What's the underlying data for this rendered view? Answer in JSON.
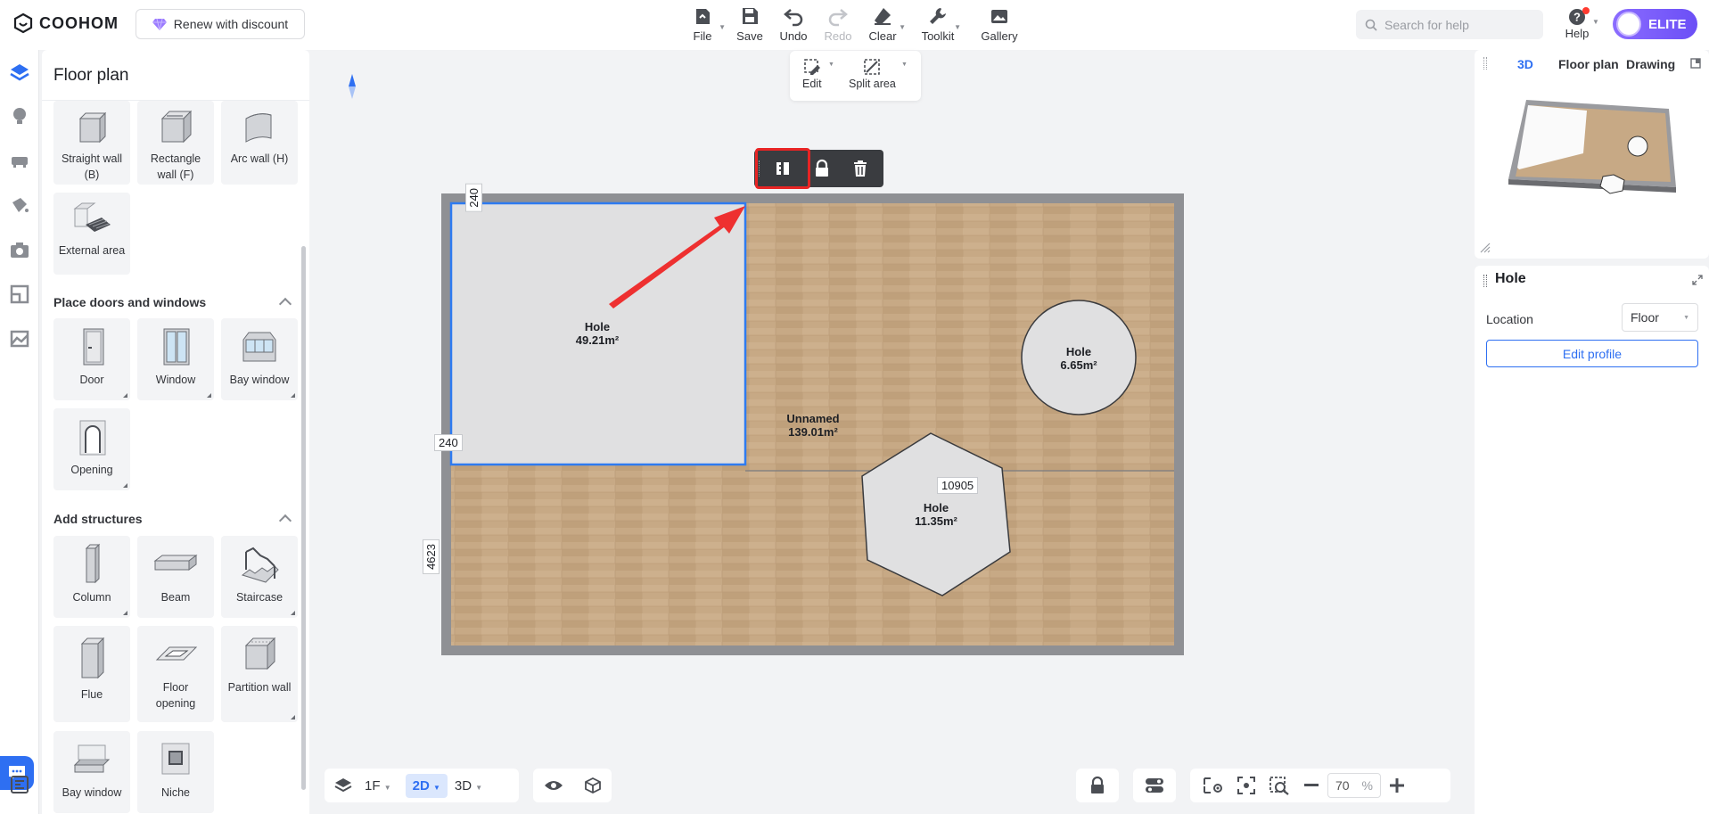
{
  "app": {
    "logo_text": "COOHOM",
    "renew_label": "Renew with discount",
    "accent": "#2e6ff2"
  },
  "toolbar": {
    "file": "File",
    "save": "Save",
    "undo": "Undo",
    "redo": "Redo",
    "clear": "Clear",
    "toolkit": "Toolkit",
    "gallery": "Gallery"
  },
  "search": {
    "placeholder": "Search for help"
  },
  "help_label": "Help",
  "elite_label": "ELITE",
  "edit_toolbar": {
    "edit": "Edit",
    "split_area": "Split area"
  },
  "panel": {
    "title": "Floor plan",
    "walls": [
      {
        "label": "Straight wall\n(B)",
        "icon": "straight-wall-icon"
      },
      {
        "label": "Rectangle\nwall (F)",
        "icon": "rectangle-wall-icon"
      },
      {
        "label": "Arc wall (H)",
        "icon": "arc-wall-icon"
      },
      {
        "label": "External area",
        "icon": "external-area-icon"
      }
    ],
    "doors_title": "Place doors and windows",
    "doors": [
      {
        "label": "Door"
      },
      {
        "label": "Window"
      },
      {
        "label": "Bay window"
      },
      {
        "label": "Opening"
      }
    ],
    "structures_title": "Add structures",
    "structures": [
      {
        "label": "Column"
      },
      {
        "label": "Beam"
      },
      {
        "label": "Staircase"
      },
      {
        "label": "Flue"
      },
      {
        "label": "Floor\nopening"
      },
      {
        "label": "Partition wall"
      },
      {
        "label": "Bay window"
      },
      {
        "label": "Niche"
      }
    ]
  },
  "plan": {
    "rooms": [
      {
        "name": "Hole",
        "area": "49.21m²"
      },
      {
        "name": "Unnamed",
        "area": "139.01m²"
      },
      {
        "name": "Hole",
        "area": "6.65m²"
      },
      {
        "name": "Hole",
        "area": "11.35m²"
      }
    ],
    "dimensions": {
      "top_wall": "240",
      "left_wall": "240",
      "height": "4623",
      "width": "10905"
    }
  },
  "bottom": {
    "floor": "1F",
    "view_2d": "2D",
    "view_3d": "3D",
    "zoom_value": "70",
    "zoom_unit": "%"
  },
  "view_panel": {
    "tab_3d": "3D",
    "tab_floor_plan": "Floor plan",
    "tab_drawing": "Drawing"
  },
  "props": {
    "title": "Hole",
    "location_label": "Location",
    "location_value": "Floor",
    "edit_profile": "Edit profile"
  }
}
